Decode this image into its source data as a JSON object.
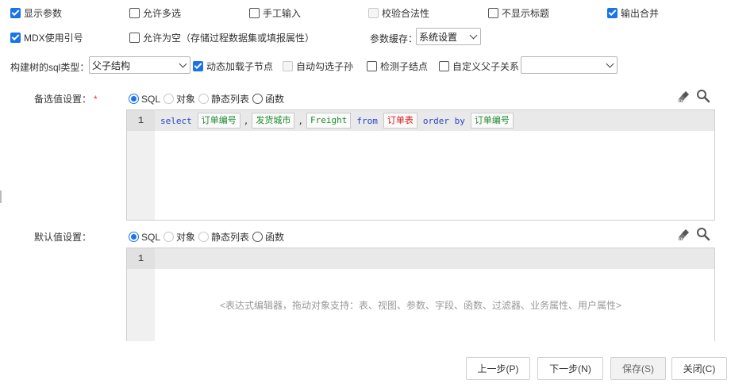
{
  "options_row1": {
    "show_params": {
      "label": "显示参数",
      "checked": true
    },
    "allow_multi": {
      "label": "允许多选",
      "checked": false
    },
    "manual_input": {
      "label": "手工输入",
      "checked": false
    },
    "validate": {
      "label": "校验合法性",
      "checked": false,
      "disabled": true
    },
    "hide_title": {
      "label": "不显示标题",
      "checked": false
    },
    "output_merge": {
      "label": "输出合并",
      "checked": true
    }
  },
  "options_row2": {
    "mdx_quote": {
      "label": "MDX使用引号",
      "checked": true
    },
    "allow_empty": {
      "label": "允许为空（存储过程数据集或填报属性）",
      "checked": false
    },
    "cache_label": "参数缓存：",
    "cache_value": "系统设置"
  },
  "options_row3": {
    "tree_sql_label": "构建树的sql类型：",
    "tree_sql_value": "父子结构",
    "dynamic_load": {
      "label": "动态加载子节点",
      "checked": true
    },
    "auto_check_desc": {
      "label": "自动勾选子孙",
      "checked": false,
      "disabled": true
    },
    "detect_child": {
      "label": "检测子结点",
      "checked": false
    },
    "custom_parent": {
      "label": "自定义父子关系",
      "checked": false
    },
    "custom_parent_value": ""
  },
  "candidate": {
    "label": "备选值设置：",
    "required_mark": "*",
    "radio_options": [
      "SQL",
      "对象",
      "静态列表",
      "函数"
    ],
    "selected": "SQL",
    "line_number": "1",
    "code": {
      "select": "select",
      "field1": "订单编号",
      "comma1": ",",
      "field2": "发货城市",
      "comma2": ",",
      "field3": "Freight",
      "from": "from",
      "table": "订单表",
      "order_by": "order by",
      "field4": "订单编号"
    }
  },
  "default_value": {
    "label": "默认值设置：",
    "radio_options": [
      "SQL",
      "对象",
      "静态列表",
      "函数"
    ],
    "selected": "SQL",
    "line_number": "1",
    "placeholder": "<表达式编辑器，拖动对象支持：表、视图、参数、字段、函数、过滤器、业务属性、用户属性>"
  },
  "footer": {
    "prev": "上一步(P)",
    "next": "下一步(N)",
    "save": "保存(S)",
    "close": "关闭(C)"
  },
  "colors": {
    "accent": "#1a73e8",
    "keyword": "#2b3fc7",
    "field": "#1e8a2e",
    "table": "#d81b1b"
  },
  "icons": [
    "broom-icon",
    "search-icon"
  ]
}
